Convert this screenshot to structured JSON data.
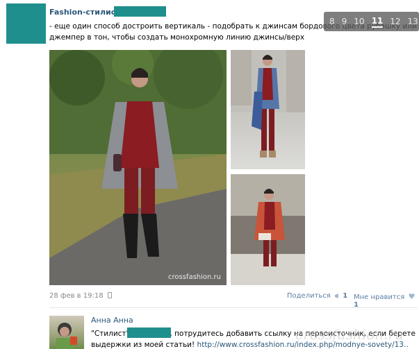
{
  "post": {
    "author": "Fashion-стилист",
    "text": "- еще один способ достроить вертикаль - подобрать к джинсам бордового цвета рубашку или джемпер в тон, чтобы создать монохромную линию джинсы/верх",
    "date": "28 фев в 19:18",
    "share_label": "Поделиться",
    "share_count": "1",
    "like_label": "Мне нравится",
    "like_count": "1",
    "photo_watermark": "crossfashion.ru"
  },
  "pager": {
    "pages": [
      "8",
      "9",
      "10",
      "11",
      "12",
      "13"
    ],
    "active": "11"
  },
  "comment": {
    "author": "Анна Анна",
    "text_before": "\"Стилист\"",
    "text_after": ", потрудитесь добавить ссылку на первоисточник, если берете",
    "text_line2": "выдержки из моей статьи!",
    "link": "http://www.crossfashion.ru/index.php/modnye-sovety/13.."
  },
  "overlay_watermark": "crossfashion.ru",
  "colors": {
    "accent": "#1f8f8d",
    "link": "#2b587a"
  }
}
